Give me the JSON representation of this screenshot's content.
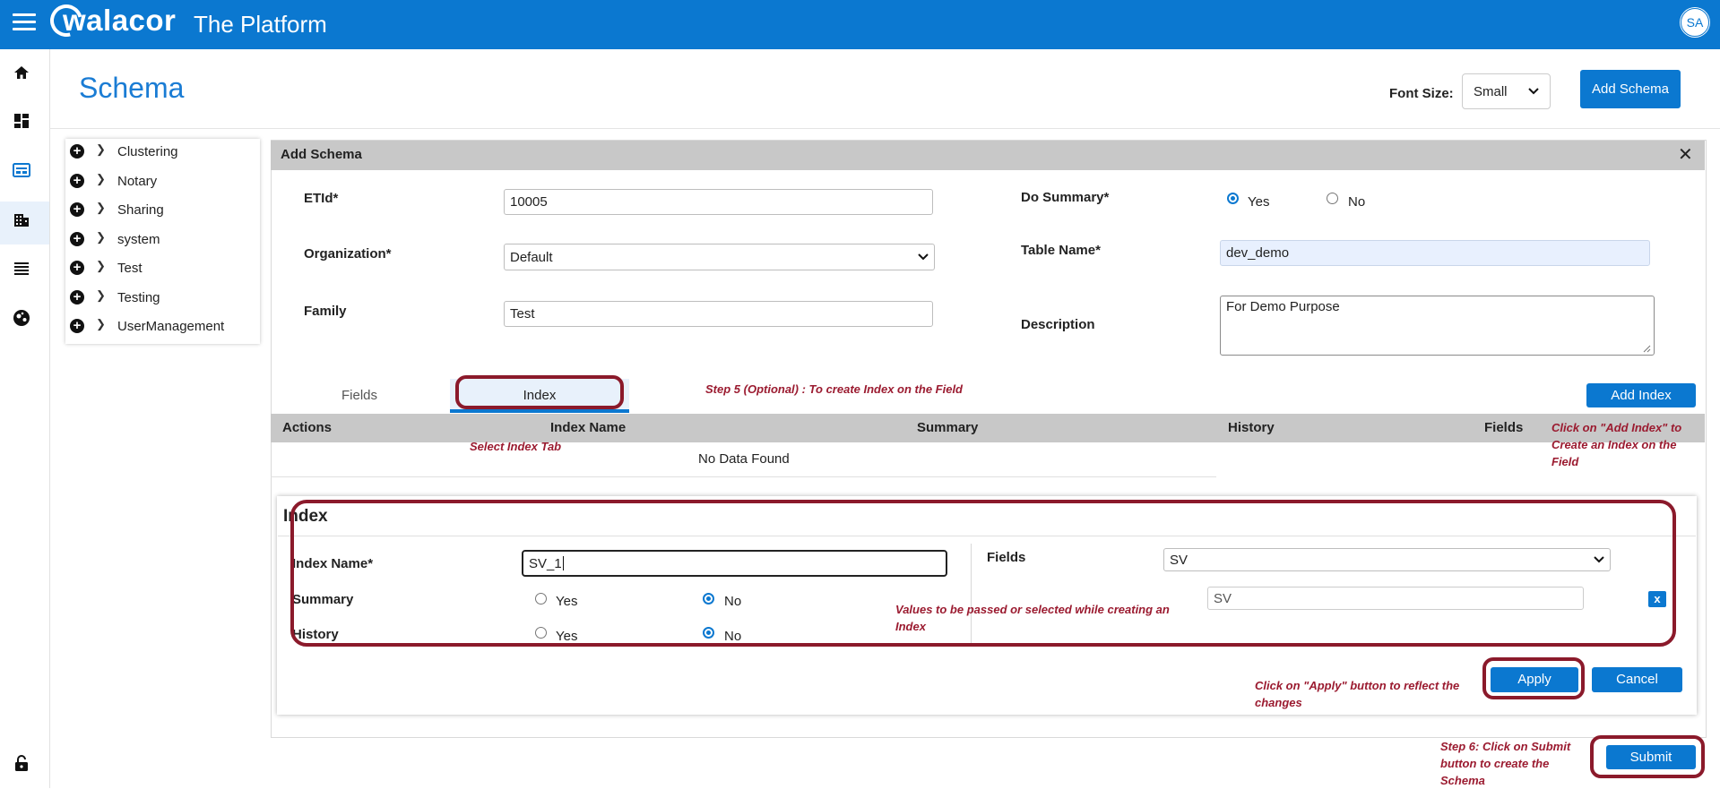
{
  "header": {
    "logo_text": "walacor",
    "app_title": "The Platform",
    "avatar_initials": "SA",
    "brand_color": "#0b78d0"
  },
  "sidebar": {
    "items": [
      {
        "icon": "home-icon"
      },
      {
        "icon": "dashboard-icon"
      },
      {
        "icon": "schema-icon",
        "active": true
      },
      {
        "icon": "building-icon"
      },
      {
        "icon": "list-icon"
      },
      {
        "icon": "globe-icon"
      },
      {
        "icon": "lock-icon"
      }
    ]
  },
  "page": {
    "title": "Schema",
    "font_size_label": "Font Size:",
    "font_size_value": "Small",
    "add_schema_label": "Add Schema"
  },
  "tree": {
    "items": [
      {
        "label": "Clustering"
      },
      {
        "label": "Notary"
      },
      {
        "label": "Sharing"
      },
      {
        "label": "system"
      },
      {
        "label": "Test"
      },
      {
        "label": "Testing"
      },
      {
        "label": "UserManagement"
      }
    ]
  },
  "panel": {
    "title": "Add Schema",
    "close_glyph": "✕",
    "etid_label": "ETId*",
    "etid_value": "10005",
    "org_label": "Organization*",
    "org_value": "Default",
    "family_label": "Family",
    "family_value": "Test",
    "do_summary_label": "Do Summary*",
    "yes_label": "Yes",
    "no_label": "No",
    "table_name_label": "Table Name*",
    "table_name_value": "dev_demo",
    "description_label": "Description",
    "description_value": "For Demo Purpose"
  },
  "tabs": {
    "fields": "Fields",
    "index": "Index",
    "add_index": "Add Index"
  },
  "table": {
    "columns": [
      "Actions",
      "Index Name",
      "Summary",
      "History",
      "Fields"
    ],
    "empty_text": "No Data Found"
  },
  "index_form": {
    "title": "Index",
    "name_label": "Index Name*",
    "name_value": "SV_1",
    "summary_label": "Summary",
    "history_label": "History",
    "yes_label": "Yes",
    "no_label": "No",
    "fields_label": "Fields",
    "fields_value": "SV",
    "selected_field": "SV",
    "remove_glyph": "x",
    "apply_label": "Apply",
    "cancel_label": "Cancel"
  },
  "submit_label": "Submit",
  "annotations": {
    "step5": "Step 5 (Optional) : To create Index on the Field",
    "select_tab": "Select Index Tab",
    "add_index_note": "Click on \"Add Index\" to Create an Index on the Field",
    "values_note": "Values to be passed or selected while creating an Index",
    "apply_note": "Click on \"Apply\" button to reflect the changes",
    "step6": "Step 6: Click on Submit button to create the Schema",
    "color": "#9b1b30"
  }
}
